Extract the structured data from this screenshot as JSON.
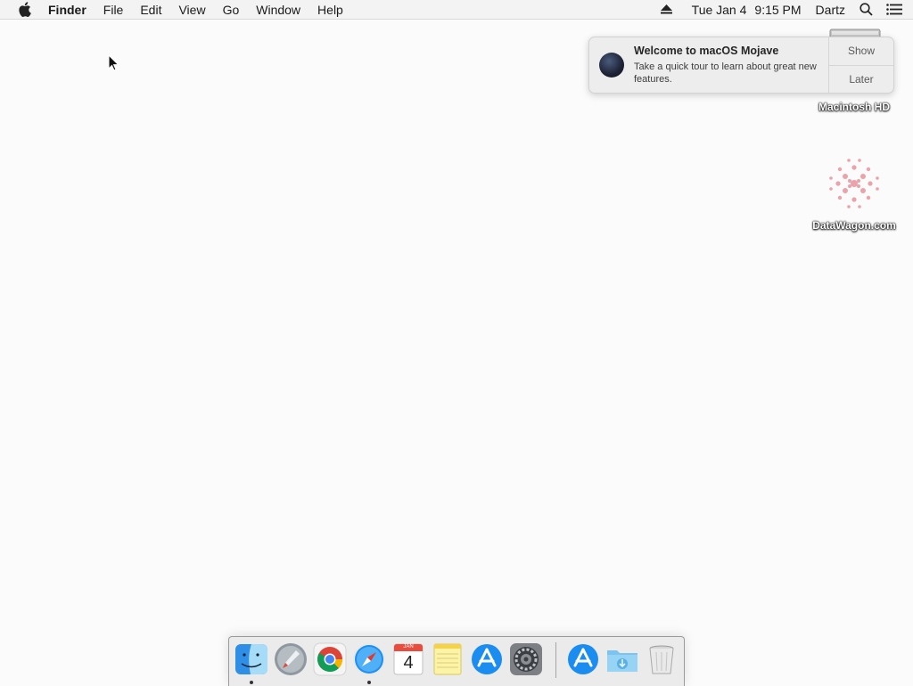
{
  "menubar": {
    "app_name": "Finder",
    "items": [
      "File",
      "Edit",
      "View",
      "Go",
      "Window",
      "Help"
    ],
    "status": {
      "date": "Tue Jan 4",
      "time": "9:15 PM",
      "user": "Dartz"
    }
  },
  "notification": {
    "title": "Welcome to macOS Mojave",
    "body": "Take a quick tour to learn about great new features.",
    "show_label": "Show",
    "later_label": "Later"
  },
  "desktop_icons": [
    {
      "label": "Macintosh HD",
      "icon": "hard-drive-icon"
    },
    {
      "label": "DataWagon.com",
      "icon": "disk-image-icon"
    }
  ],
  "dock": {
    "apps": [
      {
        "name": "finder-icon",
        "running": true
      },
      {
        "name": "launchpad-icon",
        "running": false
      },
      {
        "name": "chrome-icon",
        "running": false
      },
      {
        "name": "safari-icon",
        "running": true
      },
      {
        "name": "calendar-icon",
        "running": false,
        "month": "JAN",
        "day": "4"
      },
      {
        "name": "notes-icon",
        "running": false
      },
      {
        "name": "app-store-icon",
        "running": false
      },
      {
        "name": "system-preferences-icon",
        "running": false
      },
      {
        "name": "app-store-icon",
        "running": false
      },
      {
        "name": "downloads-folder-icon",
        "running": false
      },
      {
        "name": "trash-icon",
        "running": false
      }
    ]
  },
  "colors": {
    "desktop": "#fbfbfb",
    "menubar": "#f3f3f3",
    "notification": "#ededed"
  }
}
